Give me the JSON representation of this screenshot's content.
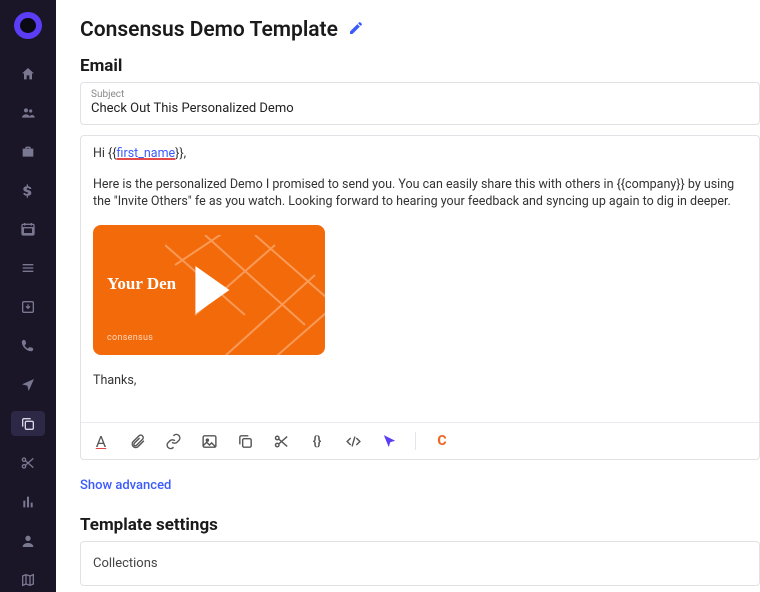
{
  "title": "Consensus Demo Template",
  "section_email": "Email",
  "subject": {
    "label": "Subject",
    "value": "Check Out This Personalized Demo"
  },
  "body": {
    "greeting_pre": "Hi {{",
    "greeting_tag": "first_name",
    "greeting_post": "}},",
    "para": "Here is the personalized Demo I promised to send you. You can easily share this with others in {{company}} by using the \"Invite Others\" fe as you watch. Looking forward to hearing your feedback and syncing up again to dig in deeper.",
    "thanks": "Thanks,"
  },
  "thumb": {
    "title": "Your Den",
    "brand": "consensus"
  },
  "show_advanced": "Show advanced",
  "section_settings": "Template settings",
  "settings_collections": "Collections"
}
